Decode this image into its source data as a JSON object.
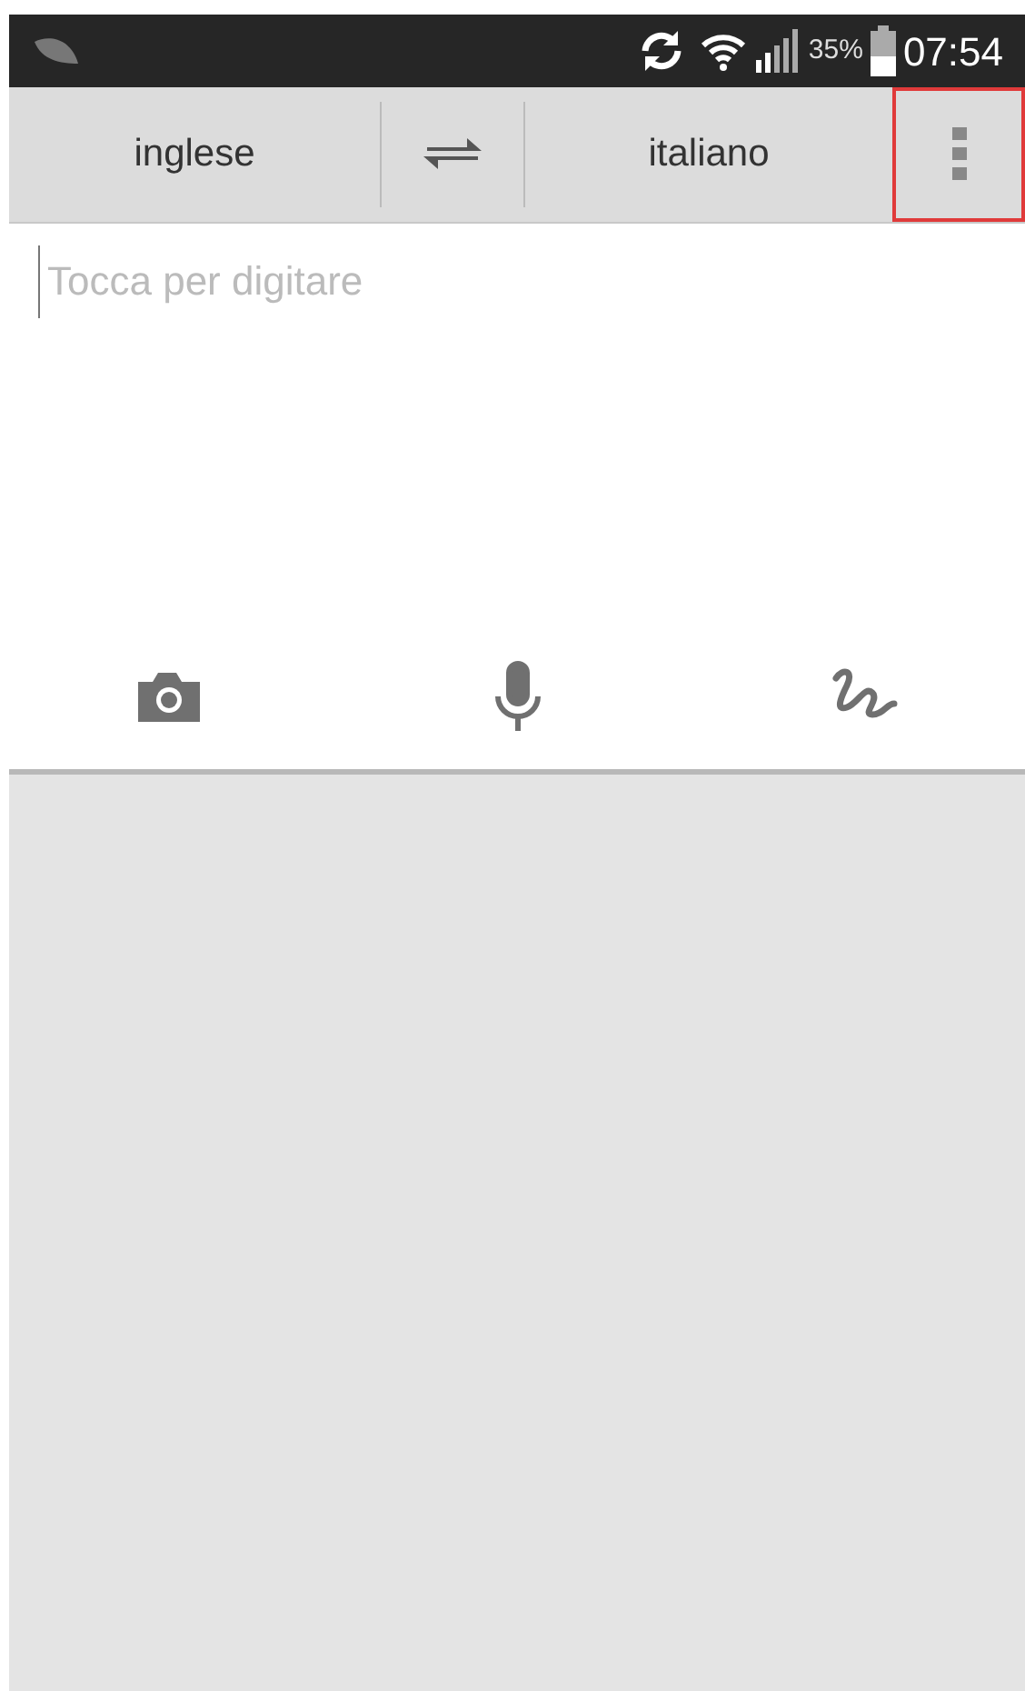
{
  "status_bar": {
    "battery_percent": "35%",
    "time": "07:54"
  },
  "toolbar": {
    "source_language": "inglese",
    "target_language": "italiano",
    "menu_button": {
      "highlighted": true
    }
  },
  "input": {
    "placeholder": "Tocca per digitare"
  },
  "input_tools": [
    {
      "kind": "camera"
    },
    {
      "kind": "microphone"
    },
    {
      "kind": "handwriting"
    }
  ]
}
